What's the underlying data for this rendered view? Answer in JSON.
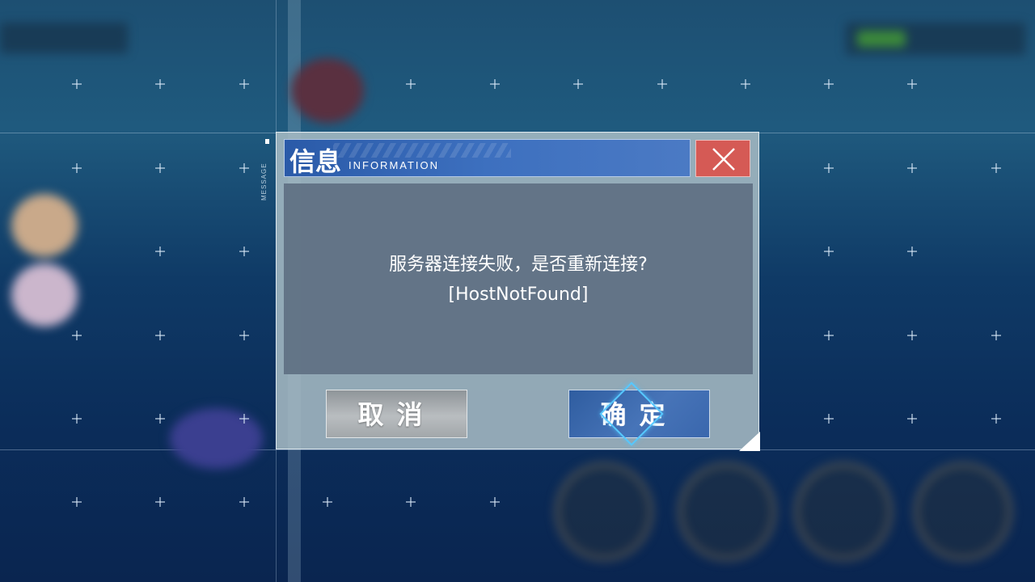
{
  "dialog": {
    "title_cn": "信息",
    "title_en": "INFORMATION",
    "side_label": "MESSAGE",
    "message_line1": "服务器连接失败，是否重新连接?",
    "message_line2": "[HostNotFound]",
    "cancel_label": "取消",
    "confirm_label": "确定",
    "close_icon": "close-x-icon"
  },
  "colors": {
    "title_bar": "#3d70bf",
    "close_button": "#d55a55",
    "confirm_button": "#4774b8",
    "cancel_button": "#b9bdc0",
    "accent_diamond": "#56c8ff"
  }
}
